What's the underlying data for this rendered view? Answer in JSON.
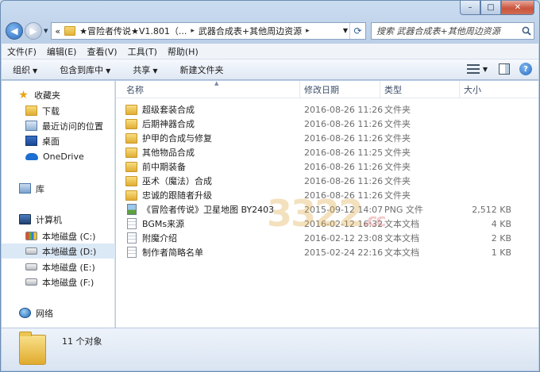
{
  "window": {
    "controls": {
      "minimize": "–",
      "maximize": "□",
      "close": "✕"
    }
  },
  "address": {
    "breadcrumbs": [
      "★冒险者传说★V1.801（...",
      "武器合成表+其他周边资源"
    ],
    "overflow_marker": "«",
    "separator": "▸"
  },
  "search": {
    "placeholder": "搜索 武器合成表+其他周边资源"
  },
  "menubar": [
    "文件(F)",
    "编辑(E)",
    "查看(V)",
    "工具(T)",
    "帮助(H)"
  ],
  "toolbar": {
    "organize": "组织",
    "include_in_library": "包含到库中",
    "share": "共享",
    "new_folder": "新建文件夹"
  },
  "navpane": {
    "favorites": "收藏夹",
    "downloads": "下载",
    "recent": "最近访问的位置",
    "desktop": "桌面",
    "onedrive": "OneDrive",
    "libraries": "库",
    "computer": "计算机",
    "drives": [
      "本地磁盘 (C:)",
      "本地磁盘 (D:)",
      "本地磁盘 (E:)",
      "本地磁盘 (F:)"
    ],
    "network": "网络"
  },
  "columns": {
    "name": "名称",
    "date": "修改日期",
    "type": "类型",
    "size": "大小"
  },
  "files": [
    {
      "name": "超级套装合成",
      "date": "2016-08-26 11:26",
      "type": "文件夹",
      "size": "",
      "icon": "folder"
    },
    {
      "name": "后期神器合成",
      "date": "2016-08-26 11:26",
      "type": "文件夹",
      "size": "",
      "icon": "folder"
    },
    {
      "name": "护甲的合成与修复",
      "date": "2016-08-26 11:26",
      "type": "文件夹",
      "size": "",
      "icon": "folder"
    },
    {
      "name": "其他物品合成",
      "date": "2016-08-26 11:25",
      "type": "文件夹",
      "size": "",
      "icon": "folder"
    },
    {
      "name": "前中期装备",
      "date": "2016-08-26 11:26",
      "type": "文件夹",
      "size": "",
      "icon": "folder"
    },
    {
      "name": "巫术（魔法）合成",
      "date": "2016-08-26 11:26",
      "type": "文件夹",
      "size": "",
      "icon": "folder"
    },
    {
      "name": "忠诚的跟随者升级",
      "date": "2016-08-26 11:26",
      "type": "文件夹",
      "size": "",
      "icon": "folder"
    },
    {
      "name": "《冒险者传说》卫星地图 BY2403",
      "date": "2015-09-12 14:07",
      "type": "PNG 文件",
      "size": "2,512 KB",
      "icon": "image"
    },
    {
      "name": "BGMs来源",
      "date": "2016-02-12 16:32",
      "type": "文本文档",
      "size": "4 KB",
      "icon": "text"
    },
    {
      "name": "附魔介绍",
      "date": "2016-02-12 23:08",
      "type": "文本文档",
      "size": "2 KB",
      "icon": "text"
    },
    {
      "name": "制作者简略名单",
      "date": "2015-02-24 22:16",
      "type": "文本文档",
      "size": "1 KB",
      "icon": "text"
    }
  ],
  "status": {
    "item_count": "11 个对象"
  },
  "watermark": {
    "main": "3322",
    "suffix": ".cc"
  }
}
